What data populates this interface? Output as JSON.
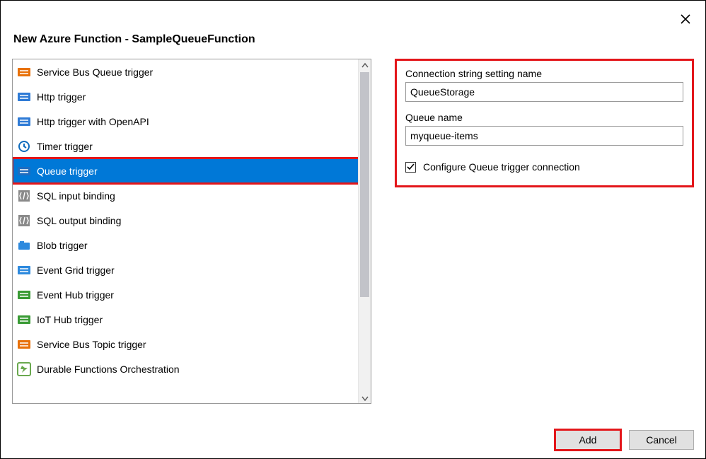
{
  "dialog": {
    "title": "New Azure Function - SampleQueueFunction"
  },
  "list": {
    "items": [
      {
        "icon": "service-bus-queue",
        "label": "Service Bus Queue trigger",
        "selected": false
      },
      {
        "icon": "http",
        "label": "Http trigger",
        "selected": false
      },
      {
        "icon": "http",
        "label": "Http trigger with OpenAPI",
        "selected": false
      },
      {
        "icon": "timer",
        "label": "Timer trigger",
        "selected": false
      },
      {
        "icon": "queue",
        "label": "Queue trigger",
        "selected": true
      },
      {
        "icon": "sql",
        "label": "SQL input binding",
        "selected": false
      },
      {
        "icon": "sql",
        "label": "SQL output binding",
        "selected": false
      },
      {
        "icon": "blob",
        "label": "Blob trigger",
        "selected": false
      },
      {
        "icon": "event-grid",
        "label": "Event Grid trigger",
        "selected": false
      },
      {
        "icon": "event-hub",
        "label": "Event Hub trigger",
        "selected": false
      },
      {
        "icon": "iot-hub",
        "label": "IoT Hub trigger",
        "selected": false
      },
      {
        "icon": "service-bus-topic",
        "label": "Service Bus Topic trigger",
        "selected": false
      },
      {
        "icon": "durable",
        "label": "Durable Functions Orchestration",
        "selected": false
      }
    ]
  },
  "form": {
    "conn_label": "Connection string setting name",
    "conn_value": "QueueStorage",
    "queue_label": "Queue name",
    "queue_value": "myqueue-items",
    "configure_label": "Configure Queue trigger connection",
    "configure_checked": true
  },
  "buttons": {
    "add": "Add",
    "cancel": "Cancel"
  },
  "icon_colors": {
    "service-bus-queue": "#e8710a",
    "http": "#2f7bd6",
    "timer": "#0f6cbd",
    "queue": "#1f6cbf",
    "sql": "#8a8a8a",
    "blob": "#2e8ade",
    "event-grid": "#2e8ade",
    "event-hub": "#3a9b35",
    "iot-hub": "#3a9b35",
    "service-bus-topic": "#e8710a",
    "durable": "#6aa84f"
  }
}
